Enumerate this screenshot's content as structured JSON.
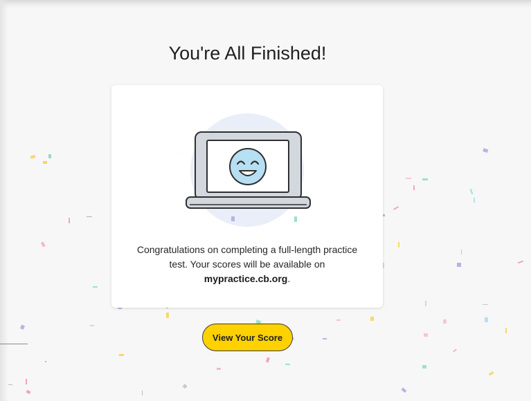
{
  "page": {
    "title": "You're All Finished!"
  },
  "card": {
    "message_line1": "Congratulations on completing a full-length practice",
    "message_line2": "test. Your scores will be available on",
    "message_domain": "mypractice.cb.org",
    "message_end": "."
  },
  "actions": {
    "view_score_label": "View Your Score"
  },
  "colors": {
    "accent_button": "#fed100",
    "face_fill": "#b6dff3",
    "laptop_fill": "#d3d7de",
    "halo_fill": "#e9eef9"
  },
  "icons": {
    "illustration": "laptop-smiley-icon"
  }
}
